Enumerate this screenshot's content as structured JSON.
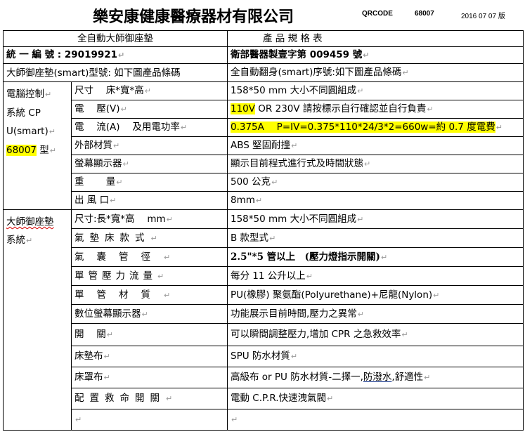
{
  "header": {
    "company": "樂安康健康醫療器材有限公司",
    "qrcode_label": "QRCODE",
    "product_no": "68007",
    "date": "2016 07 07 版"
  },
  "table": {
    "title_left": "全自動大師御座墊",
    "title_right": "產 品 規 格 表",
    "unified_no": "統 一 編 號 : 29019921",
    "license": "衛部醫器製壹字第 009459 號",
    "model_left": "大師御座墊(smart)型號: 如下圖產品條碼",
    "model_right": "全自動翻身(smart)序號:如下圖產品條碼",
    "ctrl_group": {
      "line1": "電腦控制",
      "line2": "系統 CP",
      "line3": "U(smart)",
      "line4_hl": "68007",
      "line4_rest": " 型"
    },
    "ctrl_rows": [
      {
        "label": "尺寸　 床*寬*高",
        "value": "158*50 mm 大小不同圓組成"
      },
      {
        "label": "電　 壓(V)",
        "value_hl": "110V",
        "value": " OR 230V 請按標示自行確認並自行負責"
      },
      {
        "label": "電　 流(A)　 及用電功率",
        "value_hl": "0.375A　 P=IV=0.375*110*24/3*2=660w=約 0.7 度電費",
        "value": ""
      },
      {
        "label": "外部材質",
        "value": "ABS 堅固耐撞"
      },
      {
        "label": "螢幕顯示器",
        "value": "顯示目前程式進行式及時間狀態"
      },
      {
        "label": "重　　 量",
        "value": "500 公克"
      },
      {
        "label": "出 風 口",
        "value": "8mm"
      }
    ],
    "cushion_group": {
      "line1": "大師御座墊",
      "line2": "系統"
    },
    "cushion_rows": [
      {
        "label": "尺寸:長*寬*高　 mm",
        "value": "158*50 mm 大小不同圓組成"
      },
      {
        "label": "氣墊床款式",
        "value": "B 款型式"
      },
      {
        "label": "氣囊管徑",
        "value": "2.5\"*5 管以上　(壓力燈指示開關)"
      },
      {
        "label": "單管壓力流量",
        "value": "每分 11 公升以上"
      },
      {
        "label": "單管材質",
        "value": "PU(橡膠) 聚氨酯(Polyurethane)+尼龍(Nylon)"
      },
      {
        "label": "數位螢幕顯示器",
        "value": "功能展示目前時間,壓力之異常"
      },
      {
        "label": "開　 關",
        "value": "可以瞬間調整壓力,增加 CPR 之急救效率"
      },
      {
        "label": "床墊布",
        "value": "SPU 防水材質"
      },
      {
        "label": "床罩布",
        "value_a": "高級布 or PU 防水材質-二擇一,",
        "value_b": "防潑水",
        "value_c": ",舒適性"
      },
      {
        "label": "配置救命開關",
        "value": "電動 C.P.R.快速洩氣閥"
      },
      {
        "label": "",
        "value": ""
      }
    ],
    "return_mark": "↵"
  }
}
